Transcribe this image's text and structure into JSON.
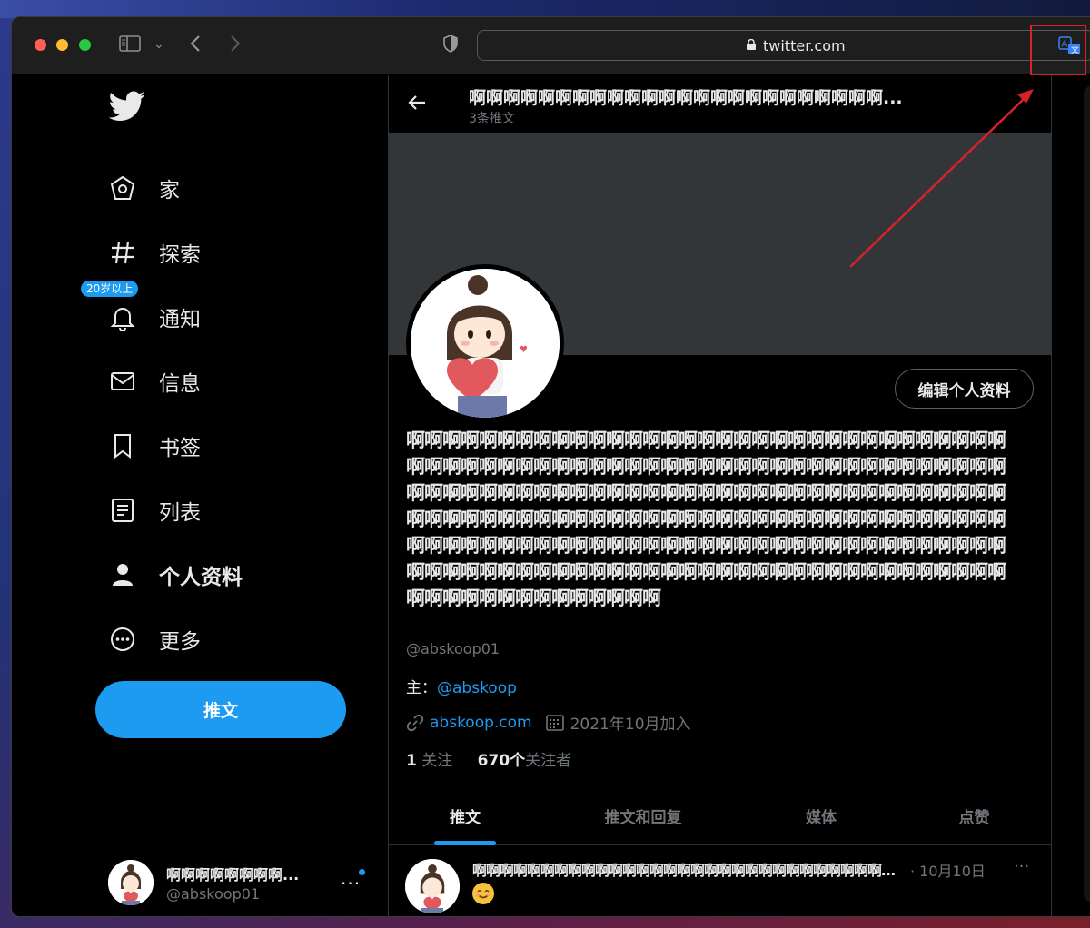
{
  "browser": {
    "url": "twitter.com"
  },
  "sidebar": {
    "items": [
      {
        "label": "家",
        "icon": "home-icon"
      },
      {
        "label": "探索",
        "icon": "hashtag-icon"
      },
      {
        "label": "通知",
        "icon": "bell-icon"
      },
      {
        "label": "信息",
        "icon": "envelope-icon"
      },
      {
        "label": "书签",
        "icon": "bookmark-icon"
      },
      {
        "label": "列表",
        "icon": "list-icon"
      },
      {
        "label": "个人资料",
        "icon": "person-icon"
      },
      {
        "label": "更多",
        "icon": "more-circle-icon"
      }
    ],
    "age_badge": "20岁以上",
    "tweet_button": "推文",
    "account": {
      "name": "啊啊啊啊啊啊啊啊...",
      "handle": "@abskoop01"
    }
  },
  "profile": {
    "header_title": "啊啊啊啊啊啊啊啊啊啊啊啊啊啊啊啊啊啊啊啊啊啊啊啊...",
    "tweet_count": "3条推文",
    "edit_button": "编辑个人资料",
    "bio": "啊啊啊啊啊啊啊啊啊啊啊啊啊啊啊啊啊啊啊啊啊啊啊啊啊啊啊啊啊啊啊啊啊啊啊啊啊啊啊啊啊啊啊啊啊啊啊啊啊啊啊啊啊啊啊啊啊啊啊啊啊啊啊啊啊啊啊啊啊啊啊啊啊啊啊啊啊啊啊啊啊啊啊啊啊啊啊啊啊啊啊啊啊啊啊啊啊啊啊啊啊啊啊啊啊啊啊啊啊啊啊啊啊啊啊啊啊啊啊啊啊啊啊啊啊啊啊啊啊啊啊啊啊啊啊啊啊啊啊啊啊啊啊啊啊啊啊啊啊啊啊啊啊啊啊啊啊啊啊啊啊啊啊啊啊啊啊啊啊啊啊啊啊啊啊啊啊啊啊啊啊啊啊啊啊啊啊啊啊啊啊啊啊啊啊啊啊啊啊啊啊啊啊啊啊啊啊啊啊啊啊啊",
    "handle": "@abskoop01",
    "owner_prefix": "主：",
    "owner_link": "@abskoop",
    "website": "abskoop.com",
    "joined": "2021年10月加入",
    "following_count": "1",
    "following_label": "关注",
    "followers_count": "670个",
    "followers_label": "关注者"
  },
  "tabs": [
    "推文",
    "推文和回复",
    "媒体",
    "点赞"
  ],
  "tweet": {
    "name": "啊啊啊啊啊啊啊啊啊啊啊啊啊啊啊啊啊啊啊啊啊啊啊啊啊啊啊啊啊啊啊...",
    "date": "· 10月10日",
    "more": "···"
  },
  "colors": {
    "accent": "#1d9bf0",
    "annotation": "#d6222a"
  }
}
